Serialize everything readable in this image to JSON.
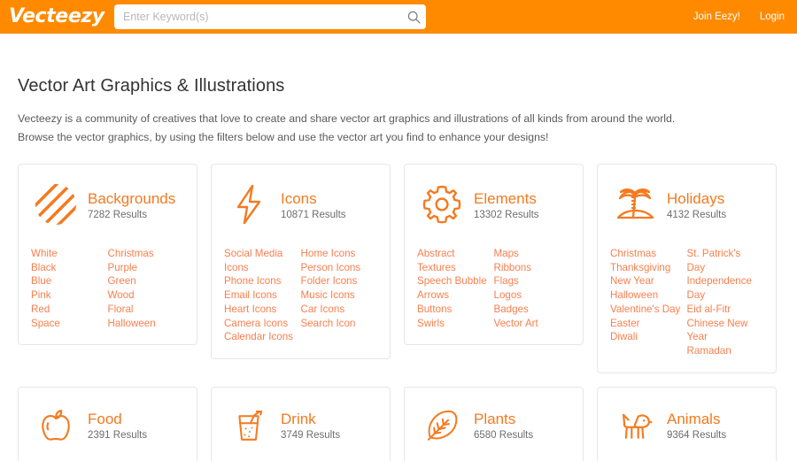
{
  "header": {
    "logo_text": "Vecteezy",
    "search": {
      "placeholder": "Enter Keyword(s)",
      "value": "",
      "icon": "search-icon"
    },
    "links": [
      {
        "label": "Join Eezy!"
      },
      {
        "label": "Login"
      }
    ],
    "background_color": "#ff8a00"
  },
  "intro": {
    "title": "Vector Art Graphics & Illustrations",
    "line1": "Vecteezy is a community of creatives that love to create and share vector art graphics and illustrations of all kinds from around the world.",
    "line2": "Browse the vector graphics, by using the filters below and use the vector art you find to enhance your designs!"
  },
  "colors": {
    "brand_orange": "#ff8a00",
    "title_orange": "#f47a20",
    "link_orange": "#f97f4e",
    "card_border": "#e6e6e6",
    "text_gray": "#5a5a5a"
  },
  "cards": [
    {
      "id": "backgrounds",
      "title": "Backgrounds",
      "results": "7282 Results",
      "icon": "striped-circle-icon",
      "tags_left": [
        "White",
        "Black",
        "Blue",
        "Pink",
        "Red",
        "Space"
      ],
      "tags_right": [
        "Christmas",
        "Purple",
        "Green",
        "Wood",
        "Floral",
        "Halloween"
      ]
    },
    {
      "id": "icons",
      "title": "Icons",
      "results": "10871 Results",
      "icon": "lightning-bolt-icon",
      "tags_left": [
        "Social Media Icons",
        "Phone Icons",
        "Email Icons",
        "Heart Icons",
        "Camera Icons",
        "Calendar Icons"
      ],
      "tags_right": [
        "Home Icons",
        "Person Icons",
        "Folder Icons",
        "Music Icons",
        "Car Icons",
        "Search Icon"
      ]
    },
    {
      "id": "elements",
      "title": "Elements",
      "results": "13302 Results",
      "icon": "gear-icon",
      "tags_left": [
        "Abstract",
        "Textures",
        "Speech Bubble",
        "Arrows",
        "Buttons",
        "Swirls"
      ],
      "tags_right": [
        "Maps",
        "Ribbons",
        "Flags",
        "Logos",
        "Badges",
        "Vector Art"
      ]
    },
    {
      "id": "holidays",
      "title": "Holidays",
      "results": "4132 Results",
      "icon": "palm-tree-island-icon",
      "tags_left": [
        "Christmas",
        "Thanksgiving",
        "New Year",
        "Halloween",
        "Valentine's Day",
        "Easter",
        "Diwali"
      ],
      "tags_right": [
        "St. Patrick's Day",
        "Independence Day",
        "Eid al-Fitr",
        "Chinese New Year",
        "Ramadan"
      ]
    },
    {
      "id": "food",
      "title": "Food",
      "results": "2391 Results",
      "icon": "apple-icon",
      "tags_left": [],
      "tags_right": []
    },
    {
      "id": "drink",
      "title": "Drink",
      "results": "3749 Results",
      "icon": "drink-glass-icon",
      "tags_left": [],
      "tags_right": []
    },
    {
      "id": "plants",
      "title": "Plants",
      "results": "6580 Results",
      "icon": "leaf-icon",
      "tags_left": [],
      "tags_right": []
    },
    {
      "id": "animals",
      "title": "Animals",
      "results": "9364 Results",
      "icon": "dog-icon",
      "tags_left": [],
      "tags_right": []
    }
  ]
}
